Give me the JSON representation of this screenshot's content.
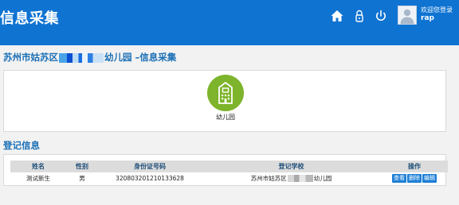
{
  "header": {
    "title": "信息采集",
    "welcome": "欢迎您登录",
    "username": "rap",
    "icons": [
      "home-icon",
      "lock-icon",
      "power-icon",
      "avatar"
    ]
  },
  "page": {
    "title_prefix": "苏州市姑苏区",
    "title_suffix": "幼儿园 –信息采集"
  },
  "categories": [
    {
      "label": "幼儿园",
      "icon": "school-building-icon",
      "color": "#7db42b"
    }
  ],
  "registration": {
    "section_title": "登记信息",
    "columns": [
      "姓名",
      "性别",
      "身份证号码",
      "登记学校",
      "操作"
    ],
    "rows": [
      {
        "name": "测试新生",
        "sex": "男",
        "id_number": "320803201210133628",
        "school_prefix": "苏州市姑苏区",
        "school_suffix": "幼儿园",
        "actions": [
          "查看",
          "删除",
          "编辑"
        ]
      }
    ]
  },
  "colors": {
    "header_bg": "#0f73d2",
    "accent_text": "#1a6fb6",
    "category_green": "#7db42b",
    "action_button": "#1e7fd6"
  }
}
